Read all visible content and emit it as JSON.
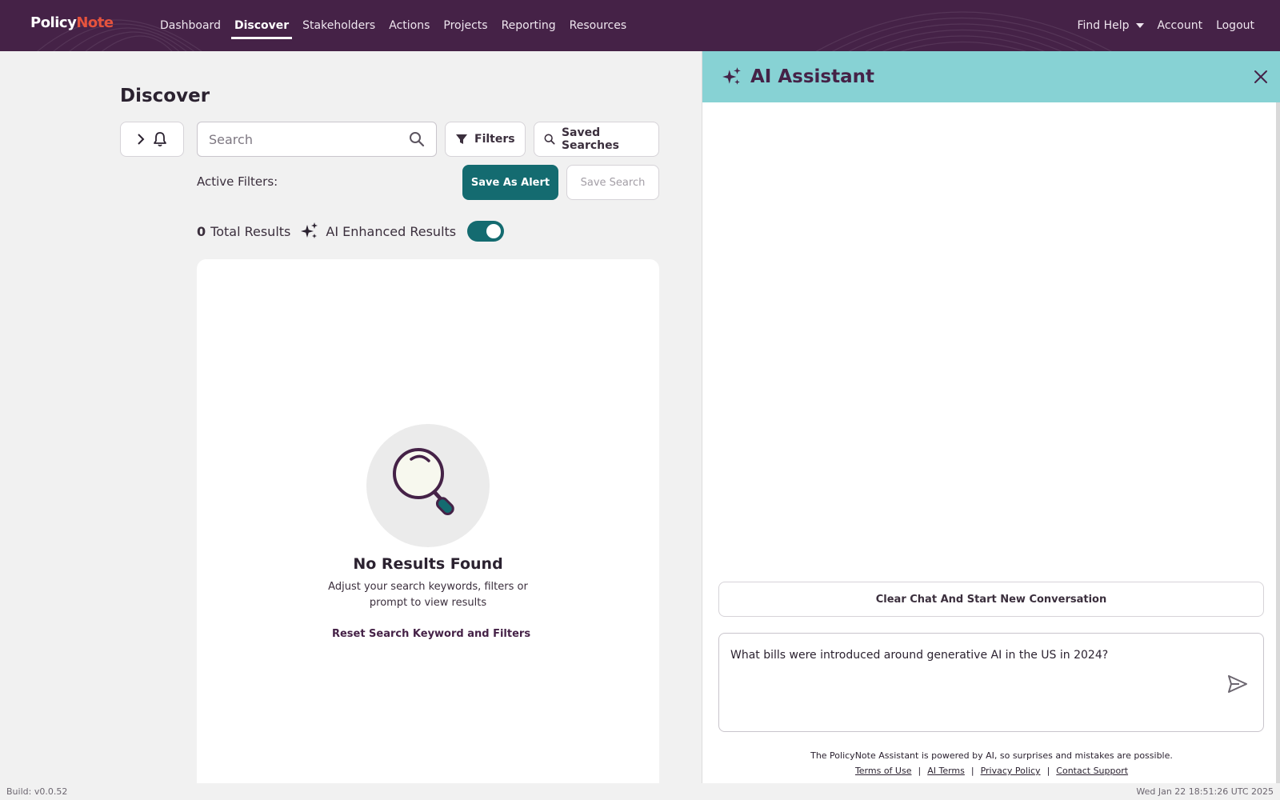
{
  "header": {
    "logo_a": "Policy",
    "logo_b": "Note",
    "nav": [
      "Dashboard",
      "Discover",
      "Stakeholders",
      "Actions",
      "Projects",
      "Reporting",
      "Resources"
    ],
    "active_nav": "Discover",
    "find_help": "Find Help",
    "account": "Account",
    "logout": "Logout"
  },
  "discover": {
    "title": "Discover",
    "search_placeholder": "Search",
    "filters_label": "Filters",
    "saved_searches_label": "Saved Searches",
    "active_filters_label": "Active Filters:",
    "save_alert_label": "Save As Alert",
    "save_search_label": "Save Search",
    "total_count": "0",
    "total_results_label": "Total Results",
    "ai_enhanced_label": "AI Enhanced Results",
    "ai_enhanced_on": true,
    "empty_title": "No Results Found",
    "empty_subtitle": "Adjust your search keywords, filters or prompt to view results",
    "reset_label": "Reset Search Keyword and Filters"
  },
  "assistant": {
    "title": "AI Assistant",
    "clear_label": "Clear Chat And Start New Conversation",
    "input_value": "What bills were introduced around generative AI in the US in 2024?",
    "disclaimer": "The PolicyNote Assistant is powered by AI, so surprises and mistakes are possible.",
    "links": [
      "Terms of Use",
      "AI Terms",
      "Privacy Policy",
      "Contact Support"
    ]
  },
  "footer": {
    "build": "Build: v0.0.52",
    "timestamp": "Wed Jan 22 18:51:26 UTC 2025"
  },
  "colors": {
    "header_bg": "#452247",
    "brand_accent": "#e5533d",
    "teal": "#146b70",
    "assistant_header": "#87d2d4"
  }
}
